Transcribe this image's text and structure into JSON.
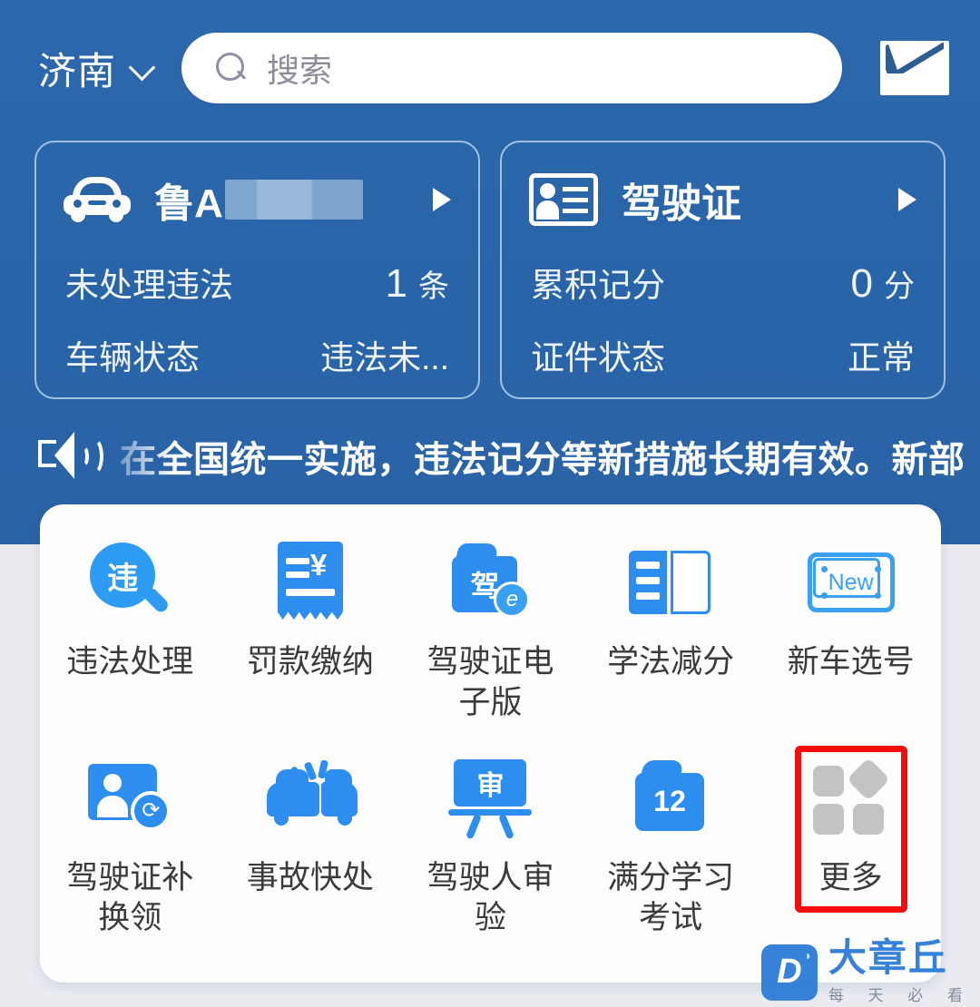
{
  "header": {
    "city": "济南",
    "city_chevron_icon": "chevron-down-icon",
    "search": {
      "icon": "search-icon",
      "placeholder": "搜索",
      "value": ""
    },
    "mail_icon": "mail-envelope-icon"
  },
  "cards": [
    {
      "icon": "car-icon",
      "title": "鲁A",
      "plate_masked": true,
      "arrow_icon": "chevron-right-icon",
      "rows": [
        {
          "label": "未处理违法",
          "value": "1",
          "unit": "条"
        },
        {
          "label": "车辆状态",
          "value": "违法未...",
          "unit": ""
        }
      ]
    },
    {
      "icon": "id-card-icon",
      "title": "驾驶证",
      "plate_masked": false,
      "arrow_icon": "chevron-right-icon",
      "rows": [
        {
          "label": "累积记分",
          "value": "0",
          "unit": "分"
        },
        {
          "label": "证件状态",
          "value": "正常",
          "unit": ""
        }
      ]
    }
  ],
  "announcement": {
    "icon": "speaker-icon",
    "text": "在全国统一实施，违法记分等新措施长期有效。新部"
  },
  "grid": {
    "rows": [
      [
        {
          "label": "违法处理",
          "icon": "violation-search-icon",
          "glyph": "违",
          "highlighted": false
        },
        {
          "label": "罚款缴纳",
          "icon": "receipt-yuan-icon",
          "glyph": "¥",
          "highlighted": false
        },
        {
          "label": "驾驶证电子版",
          "icon": "license-wallet-icon",
          "glyph": "驾",
          "badge": "e",
          "highlighted": false
        },
        {
          "label": "学法减分",
          "icon": "open-book-icon",
          "glyph": "",
          "highlighted": false
        },
        {
          "label": "新车选号",
          "icon": "license-plate-new-icon",
          "glyph": "New",
          "highlighted": false
        }
      ],
      [
        {
          "label": "驾驶证补换领",
          "icon": "person-card-refresh-icon",
          "glyph": "⟳",
          "highlighted": false
        },
        {
          "label": "事故快处",
          "icon": "car-crash-icon",
          "glyph": "",
          "highlighted": false
        },
        {
          "label": "驾驶人审验",
          "icon": "review-board-icon",
          "glyph": "审",
          "highlighted": false
        },
        {
          "label": "满分学习考试",
          "icon": "folder-12-icon",
          "glyph": "12",
          "highlighted": false
        },
        {
          "label": "更多",
          "icon": "more-grid-icon",
          "glyph": "",
          "highlighted": true
        }
      ]
    ]
  },
  "watermark": {
    "logo_letter": "D",
    "logo_mark_icon": "wifi-waves-icon",
    "title": "大章丘",
    "subtitle": "每 天 必 看"
  },
  "colors": {
    "hero_blue": "#2a64a8",
    "icon_blue": "#2e8ef0",
    "highlight_red": "#f40d0d",
    "panel_white": "#fdfdfd",
    "page_bg": "#e9ebf1"
  }
}
